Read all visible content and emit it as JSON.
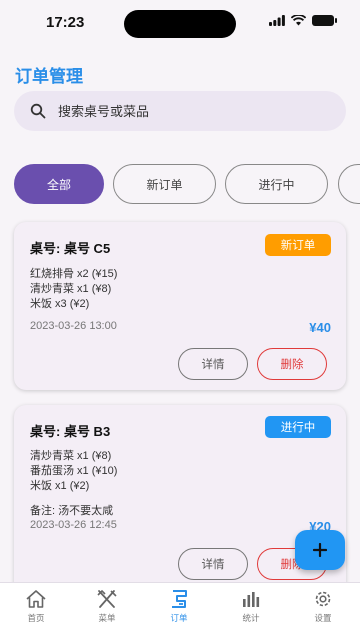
{
  "status": {
    "time": "17:23"
  },
  "header": {
    "title": "订单管理"
  },
  "search": {
    "placeholder": "搜索桌号或菜品"
  },
  "filters": [
    {
      "label": "全部",
      "active": true
    },
    {
      "label": "新订单",
      "active": false
    },
    {
      "label": "进行中",
      "active": false
    }
  ],
  "orders": [
    {
      "table": "桌号: 桌号 C5",
      "status": "新订单",
      "items": [
        "红烧排骨 x2 (¥15)",
        "清炒青菜 x1 (¥8)",
        "米饭 x3 (¥2)"
      ],
      "time": "2023-03-26 13:00",
      "amount": "¥40",
      "detail_label": "详情",
      "delete_label": "删除"
    },
    {
      "table": "桌号: 桌号 B3",
      "status": "进行中",
      "items": [
        "清炒青菜 x1 (¥8)",
        "番茄蛋汤 x1 (¥10)",
        "米饭 x1 (¥2)"
      ],
      "note": "备注: 汤不要太咸",
      "time": "2023-03-26 12:45",
      "amount": "¥20",
      "detail_label": "详情",
      "delete_label": "删除"
    }
  ],
  "fab": {
    "symbol": "+"
  },
  "bottom_nav": [
    {
      "label": "首页",
      "icon": "home-icon",
      "active": false
    },
    {
      "label": "菜单",
      "icon": "utensils-icon",
      "active": false
    },
    {
      "label": "订单",
      "icon": "receipt-icon",
      "active": true
    },
    {
      "label": "统计",
      "icon": "bar-chart-icon",
      "active": false
    },
    {
      "label": "设置",
      "icon": "gear-icon",
      "active": false
    }
  ],
  "colors": {
    "accent": "#2a8ee8",
    "chip_active": "#6a4fae",
    "badge_new": "#ff9d00",
    "badge_progress": "#2196f3",
    "delete": "#e03a3a"
  }
}
